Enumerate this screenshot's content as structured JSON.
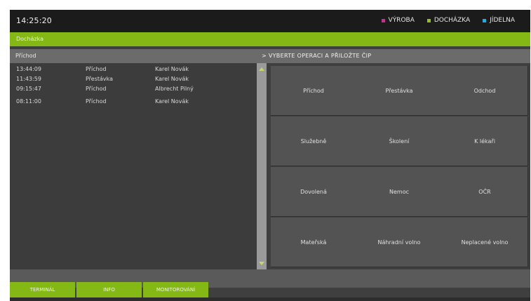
{
  "header": {
    "clock": "14:25:20",
    "modules": [
      {
        "label": "VÝROBA",
        "color": "#c0328b"
      },
      {
        "label": "DOCHÁZKA",
        "color": "#8fc21a"
      },
      {
        "label": "JÍDELNA",
        "color": "#2aa8e0"
      }
    ]
  },
  "section": {
    "title": "Docházka",
    "left_header": "Příchod",
    "right_header": "> VYBERTE OPERACI A PŘILOŽTE ČIP"
  },
  "log": {
    "rows": [
      {
        "time": "13:44:09",
        "action": "Příchod",
        "name": "Karel Novák"
      },
      {
        "time": "11:43:59",
        "action": "Přestávka",
        "name": "Karel Novák"
      },
      {
        "time": "09:15:47",
        "action": "Příchod",
        "name": "Albrecht Pilný"
      },
      {
        "time": "08:11:00",
        "action": "Příchod",
        "name": "Karel Novák"
      }
    ]
  },
  "operations": [
    "Příchod",
    "Přestávka",
    "Odchod",
    "Služebně",
    "Školení",
    "K lékaři",
    "Dovolená",
    "Nemoc",
    "OČR",
    "Mateřská",
    "Náhradní volno",
    "Neplacené volno"
  ],
  "tabs": [
    "TERMINÁL",
    "INFO",
    "MONITOROVÁNÍ"
  ]
}
